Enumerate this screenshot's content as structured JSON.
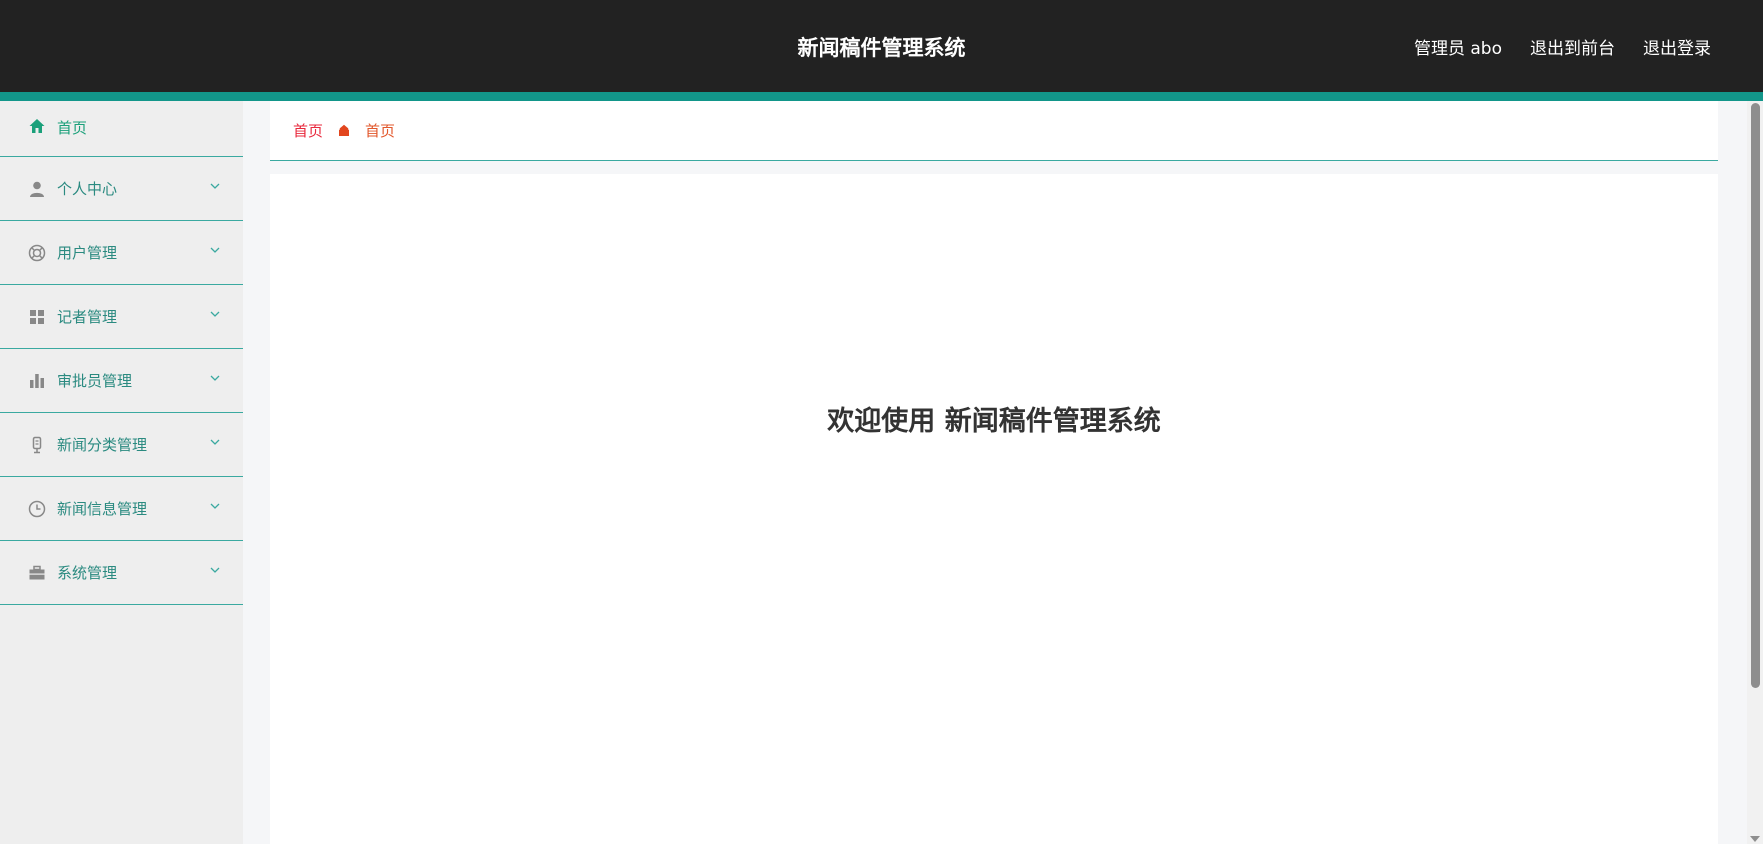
{
  "header": {
    "title": "新闻稿件管理系统",
    "user_label": "管理员 abo",
    "back_to_front": "退出到前台",
    "logout": "退出登录",
    "accent_color": "#12968a",
    "bg_color": "#222222"
  },
  "sidebar": {
    "items": [
      {
        "label": "首页",
        "icon": "home-icon"
      },
      {
        "label": "个人中心",
        "icon": "user-icon"
      },
      {
        "label": "用户管理",
        "icon": "lifebuoy-icon"
      },
      {
        "label": "记者管理",
        "icon": "grid-icon"
      },
      {
        "label": "审批员管理",
        "icon": "bar-chart-icon"
      },
      {
        "label": "新闻分类管理",
        "icon": "microphone-icon"
      },
      {
        "label": "新闻信息管理",
        "icon": "clock-icon"
      },
      {
        "label": "系统管理",
        "icon": "briefcase-icon"
      }
    ]
  },
  "breadcrumb": {
    "home": "首页",
    "separator_icon": "home-small-icon",
    "current": "首页"
  },
  "main": {
    "welcome": "欢迎使用 新闻稿件管理系统"
  }
}
